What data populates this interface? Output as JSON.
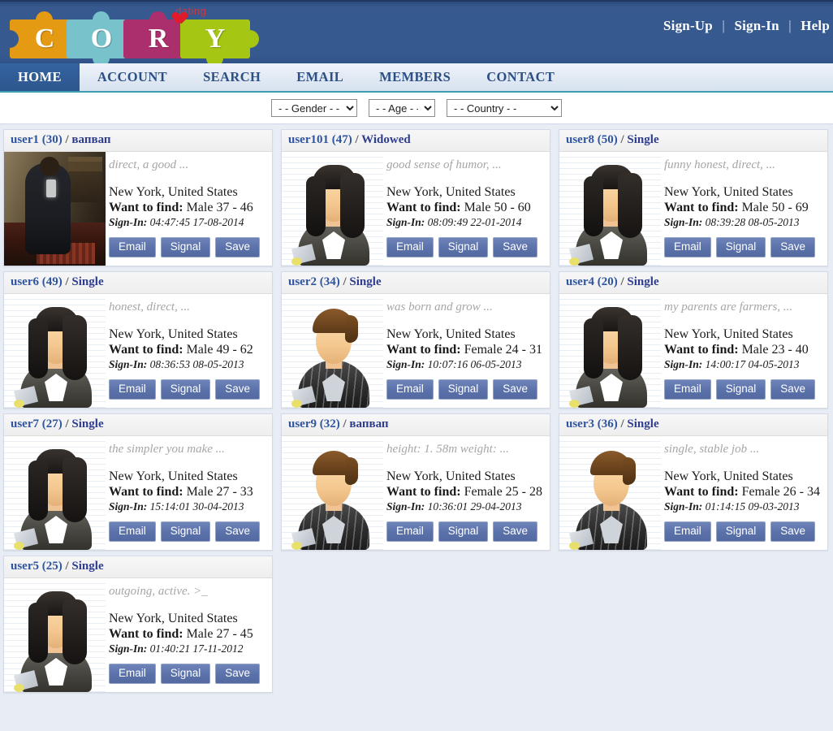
{
  "header": {
    "logo_letters": [
      "C",
      "O",
      "R",
      "Y"
    ],
    "logo_tagline": "dating",
    "links": [
      {
        "label": "Sign-Up"
      },
      {
        "label": "Sign-In"
      },
      {
        "label": "Help"
      }
    ],
    "separator": "|"
  },
  "nav": {
    "items": [
      {
        "label": "HOME",
        "active": true
      },
      {
        "label": "ACCOUNT",
        "active": false
      },
      {
        "label": "SEARCH",
        "active": false
      },
      {
        "label": "EMAIL",
        "active": false
      },
      {
        "label": "MEMBERS",
        "active": false
      },
      {
        "label": "CONTACT",
        "active": false
      }
    ]
  },
  "filters": [
    {
      "name": "gender",
      "selected": "- - Gender - -"
    },
    {
      "name": "age",
      "selected": "- - Age - -"
    },
    {
      "name": "country",
      "selected": "- - Country - -"
    }
  ],
  "labels": {
    "want_to_find": "Want to find:",
    "sign_in": "Sign-In:",
    "email_button": "Email",
    "signal_button": "Signal",
    "save_button": "Save"
  },
  "colors": {
    "header_blue": "#36598f",
    "nav_active": "#2d568d",
    "button_blue": "#5a71aa",
    "username_blue": "#2f54a0",
    "page_bg": "#e7ecf5",
    "tagline_gray": "#a6a6a6"
  },
  "profiles": [
    {
      "username": "user1",
      "age": "30",
      "status": "вапвап",
      "tagline": "direct, a good ...",
      "location": "New York, United States",
      "want": "Male 37 - 46",
      "signin": "04:47:45 17-08-2014",
      "avatar": "photo"
    },
    {
      "username": "user101",
      "age": "47",
      "status": "Widowed",
      "tagline": "good sense of humor, ...",
      "location": "New York, United States",
      "want": "Male 50 - 60",
      "signin": "08:09:49 22-01-2014",
      "avatar": "female"
    },
    {
      "username": "user8",
      "age": "50",
      "status": "Single",
      "tagline": "funny honest, direct, ...",
      "location": "New York, United States",
      "want": "Male 50 - 69",
      "signin": "08:39:28 08-05-2013",
      "avatar": "female"
    },
    {
      "username": "user6",
      "age": "49",
      "status": "Single",
      "tagline": "honest, direct, ...",
      "location": "New York, United States",
      "want": "Male 49 - 62",
      "signin": "08:36:53 08-05-2013",
      "avatar": "female"
    },
    {
      "username": "user2",
      "age": "34",
      "status": "Single",
      "tagline": "was born and grow ...",
      "location": "New York, United States",
      "want": "Female 24 - 31",
      "signin": "10:07:16 06-05-2013",
      "avatar": "male"
    },
    {
      "username": "user4",
      "age": "20",
      "status": "Single",
      "tagline": "my parents are farmers, ...",
      "location": "New York, United States",
      "want": "Male 23 - 40",
      "signin": "14:00:17 04-05-2013",
      "avatar": "female"
    },
    {
      "username": "user7",
      "age": "27",
      "status": "Single",
      "tagline": "the simpler you make ...",
      "location": "New York, United States",
      "want": "Male 27 - 33",
      "signin": "15:14:01 30-04-2013",
      "avatar": "female"
    },
    {
      "username": "user9",
      "age": "32",
      "status": "вапвап",
      "tagline": "height: 1. 58m weight: ...",
      "location": "New York, United States",
      "want": "Female 25 - 28",
      "signin": "10:36:01 29-04-2013",
      "avatar": "male"
    },
    {
      "username": "user3",
      "age": "36",
      "status": "Single",
      "tagline": "single, stable job ...",
      "location": "New York, United States",
      "want": "Female 26 - 34",
      "signin": "01:14:15 09-03-2013",
      "avatar": "male"
    },
    {
      "username": "user5",
      "age": "25",
      "status": "Single",
      "tagline": "outgoing, active. >_",
      "location": "New York, United States",
      "want": "Male 27 - 45",
      "signin": "01:40:21 17-11-2012",
      "avatar": "female"
    }
  ]
}
